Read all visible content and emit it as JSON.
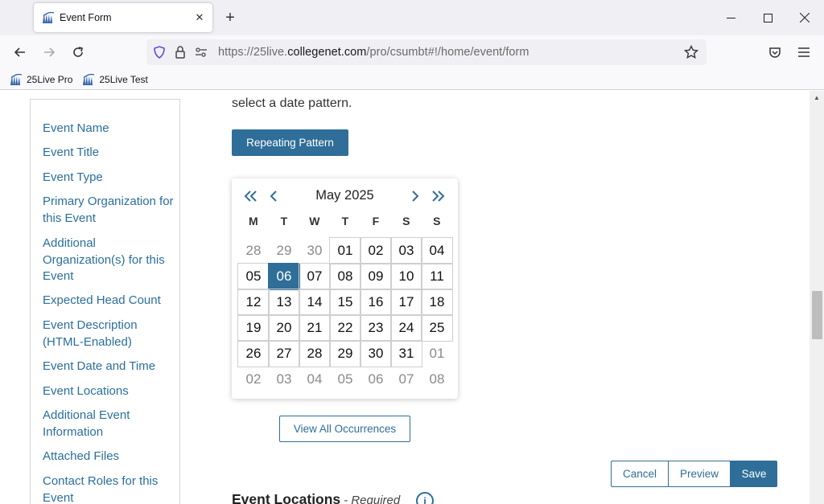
{
  "browser": {
    "tab_title": "Event Form",
    "url_prefix": "https://25live.",
    "url_domain": "collegenet.com",
    "url_path": "/pro/csumbt#!/home/event/form",
    "bookmarks": [
      {
        "label": "25Live Pro"
      },
      {
        "label": "25Live Test"
      }
    ],
    "favicon_color": "#2a5ea8"
  },
  "sidebar": {
    "items": [
      {
        "label": "Event Name"
      },
      {
        "label": "Event Title"
      },
      {
        "label": "Event Type"
      },
      {
        "label": "Primary Organization for this Event"
      },
      {
        "label": "Additional Organization(s) for this Event"
      },
      {
        "label": "Expected Head Count"
      },
      {
        "label": "Event Description (HTML-Enabled)"
      },
      {
        "label": "Event Date and Time"
      },
      {
        "label": "Event Locations"
      },
      {
        "label": "Additional Event Information"
      },
      {
        "label": "Attached Files"
      },
      {
        "label": "Contact Roles for this Event"
      }
    ]
  },
  "main": {
    "intro_text": "select a date pattern.",
    "repeat_button": "Repeating Pattern",
    "view_all_button": "View All Occurrences",
    "cancel_button": "Cancel",
    "preview_button": "Preview",
    "save_button": "Save",
    "section_title": "Event Locations",
    "section_required": "- Required"
  },
  "calendar": {
    "month_label": "May 2025",
    "weekdays": [
      "M",
      "T",
      "W",
      "T",
      "F",
      "S",
      "S"
    ],
    "weeks": [
      [
        "28",
        "29",
        "30",
        "01",
        "02",
        "03",
        "04"
      ],
      [
        "05",
        "06",
        "07",
        "08",
        "09",
        "10",
        "11"
      ],
      [
        "12",
        "13",
        "14",
        "15",
        "16",
        "17",
        "18"
      ],
      [
        "19",
        "20",
        "21",
        "22",
        "23",
        "24",
        "25"
      ],
      [
        "26",
        "27",
        "28",
        "29",
        "30",
        "31",
        "01"
      ],
      [
        "02",
        "03",
        "04",
        "05",
        "06",
        "07",
        "08"
      ]
    ],
    "selected_day": "06",
    "accent_color": "#2f6e98"
  }
}
